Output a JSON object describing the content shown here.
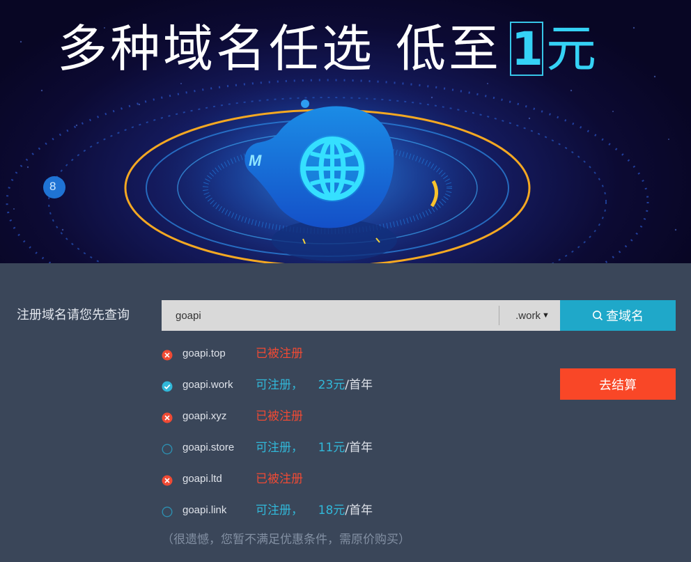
{
  "hero": {
    "title_part1": "多种域名任选",
    "title_part2": "低至",
    "price_number": "1",
    "price_unit": "元",
    "badge_letter": "M",
    "side_icon_label": "8"
  },
  "search": {
    "label": "注册域名请您先查询",
    "input_value": "goapi",
    "suffix_selected": ".work",
    "button_label": "查域名"
  },
  "checkout": {
    "button_label": "去结算"
  },
  "results": [
    {
      "domain": "goapi.top",
      "status": "已被注册",
      "state": "taken"
    },
    {
      "domain": "goapi.work",
      "status": "可注册，",
      "price": "23元",
      "unit": "/首年",
      "state": "selected"
    },
    {
      "domain": "goapi.xyz",
      "status": "已被注册",
      "state": "taken"
    },
    {
      "domain": "goapi.store",
      "status": "可注册，",
      "price": "11元",
      "unit": "/首年",
      "state": "available"
    },
    {
      "domain": "goapi.ltd",
      "status": "已被注册",
      "state": "taken"
    },
    {
      "domain": "goapi.link",
      "status": "可注册，",
      "price": "18元",
      "unit": "/首年",
      "state": "available"
    }
  ],
  "notice": "（很遗憾，您暂不满足优惠条件，需原价购买）",
  "colors": {
    "accent_cyan": "#1fa8c9",
    "checkout_red": "#f94727",
    "taken_red": "#f04a34",
    "available_blue": "#31b8d9",
    "panel_bg": "#3a4659"
  }
}
